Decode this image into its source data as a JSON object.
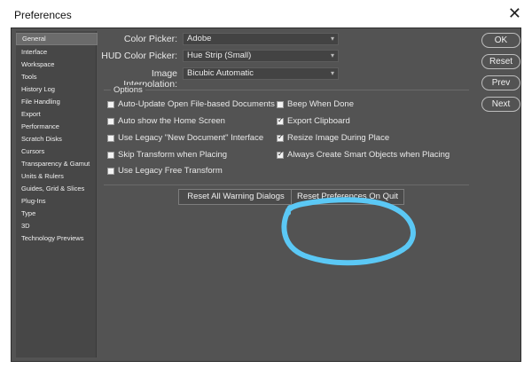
{
  "window": {
    "title": "Preferences",
    "close_glyph": "✕"
  },
  "sidebar": {
    "items": [
      {
        "label": "General",
        "selected": true
      },
      {
        "label": "Interface"
      },
      {
        "label": "Workspace"
      },
      {
        "label": "Tools"
      },
      {
        "label": "History Log"
      },
      {
        "label": "File Handling"
      },
      {
        "label": "Export"
      },
      {
        "label": "Performance"
      },
      {
        "label": "Scratch Disks"
      },
      {
        "label": "Cursors"
      },
      {
        "label": "Transparency & Gamut"
      },
      {
        "label": "Units & Rulers"
      },
      {
        "label": "Guides, Grid & Slices"
      },
      {
        "label": "Plug-Ins"
      },
      {
        "label": "Type"
      },
      {
        "label": "3D"
      },
      {
        "label": "Technology Previews"
      }
    ]
  },
  "fields": {
    "color_picker": {
      "label": "Color Picker:",
      "value": "Adobe"
    },
    "hud_color_picker": {
      "label": "HUD Color Picker:",
      "value": "Hue Strip (Small)"
    },
    "image_interpolation": {
      "label": "Image Interpolation:",
      "value": "Bicubic Automatic"
    }
  },
  "options": {
    "title": "Options",
    "left": [
      {
        "label": "Auto-Update Open File-based Documents",
        "checked": false
      },
      {
        "label": "Auto show the Home Screen",
        "checked": false
      },
      {
        "label": "Use Legacy \"New Document\" Interface",
        "checked": false
      },
      {
        "label": "Skip Transform when Placing",
        "checked": false
      },
      {
        "label": "Use Legacy Free Transform",
        "checked": false
      }
    ],
    "right": [
      {
        "label": "Beep When Done",
        "checked": false
      },
      {
        "label": "Export Clipboard",
        "checked": true
      },
      {
        "label": "Resize Image During Place",
        "checked": true
      },
      {
        "label": "Always Create Smart Objects when Placing",
        "checked": true
      }
    ]
  },
  "buttons": {
    "reset_warnings": "Reset All Warning Dialogs",
    "reset_prefs": "Reset Preferences On Quit",
    "ok": "OK",
    "reset": "Reset",
    "prev": "Prev",
    "next": "Next"
  },
  "colors": {
    "dialog_bg": "#535353",
    "sidebar_bg": "#474747",
    "annotation": "#5bc8f5"
  }
}
